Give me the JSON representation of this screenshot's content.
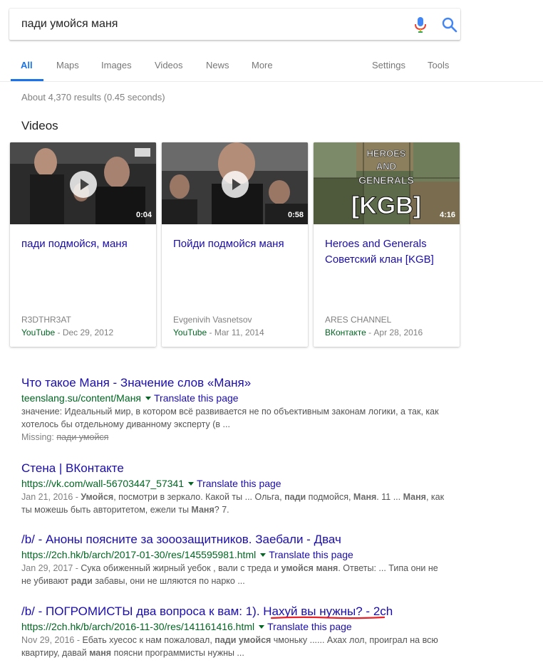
{
  "search": {
    "query": "пади умойся маня"
  },
  "tabs": [
    {
      "label": "All",
      "active": true
    },
    {
      "label": "Maps"
    },
    {
      "label": "Images"
    },
    {
      "label": "Videos"
    },
    {
      "label": "News"
    },
    {
      "label": "More"
    },
    {
      "label": "Settings"
    },
    {
      "label": "Tools"
    }
  ],
  "stats": "About 4,370 results (0.45 seconds)",
  "videos": {
    "heading": "Videos",
    "items": [
      {
        "title": "пади подмойся, маня",
        "duration": "0:04",
        "channel": "R3DTHR3AT",
        "site": "YouTube",
        "date": " - Dec 29, 2012"
      },
      {
        "title": "Пойди подмойся маня",
        "duration": "0:58",
        "channel": "Evgenivih Vasnetsov",
        "site": "YouTube",
        "date": " - Mar 11, 2014"
      },
      {
        "title": "Heroes and Generals Советский клан [KGB]",
        "duration": "4:16",
        "channel": "ARES CHANNEL",
        "site": "ВКонтакте",
        "date": " - Apr 28, 2016",
        "thumb_text": [
          "HEROES",
          "AND",
          "GENERALS",
          "[KGB]"
        ]
      }
    ]
  },
  "results": [
    {
      "title": "Что такое Маня - Значение слов «Маня»",
      "url": "teenslang.su/content/Маня",
      "translate": "Translate this page",
      "snippet": "значение: Идеальный мир, в котором всё развивается не по объективным законам логики, а так, как хотелось бы отдельному диванному эксперту (в ...",
      "missing_label": "Missing: ",
      "missing_terms": "пади умойся"
    },
    {
      "title": "Стена | ВКонтакте",
      "url": "https://vk.com/wall-56703447_57341",
      "translate": "Translate this page",
      "date": "Jan 21, 2016 - ",
      "snippet_parts": [
        "Умойся",
        ", посмотри в зеркало. Какой ты ... Ольга, ",
        "пади",
        " подмойся, ",
        "Маня",
        ". 11 ... ",
        "Маня",
        ", как ты можешь быть авторитетом, ежели ты ",
        "Маня",
        "? 7."
      ]
    },
    {
      "title": "/b/ - Аноны поясните за зооозащитников. Заебали - Двач",
      "url": "https://2ch.hk/b/arch/2017-01-30/res/145595981.html",
      "translate": "Translate this page",
      "date": "Jan 29, 2017 - ",
      "snippet_parts": [
        "Сука обиженный жирный уебок , вали с треда и ",
        "умойся маня",
        ". Ответы: ... Типа они не не убивают ",
        "ради",
        " забавы, они не шляются по нарко ..."
      ]
    },
    {
      "title": "/b/ - ПОГРОМИСТЫ два вопроса к вам: 1). Нахуй вы нужны? - 2ch",
      "url": "https://2ch.hk/b/arch/2016-11-30/res/141161416.html",
      "translate": "Translate this page",
      "date": "Nov 29, 2016 - ",
      "snippet_parts": [
        "Ебать хуесос к нам пожаловал, ",
        "пади умойся",
        " чмоньку ...... Ахах лол, проиграл на всю квартиру, давай ",
        "маня",
        " поясни программисты нужны ..."
      ]
    }
  ],
  "colors": {
    "link": "#1a0dab",
    "url_green": "#006621",
    "accent_blue": "#1a73e8",
    "annotation_red": "#e8202a"
  }
}
